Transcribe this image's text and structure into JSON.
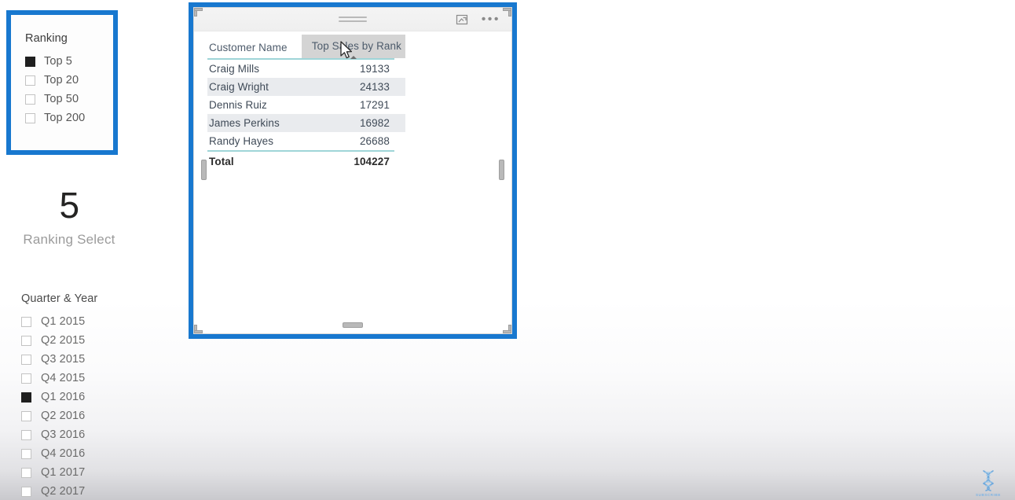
{
  "ranking_slicer": {
    "title": "Ranking",
    "items": [
      {
        "label": "Top 5",
        "checked": true
      },
      {
        "label": "Top 20",
        "checked": false
      },
      {
        "label": "Top 50",
        "checked": false
      },
      {
        "label": "Top 200",
        "checked": false
      }
    ]
  },
  "card": {
    "value": "5",
    "label": "Ranking Select"
  },
  "quarter_slicer": {
    "title": "Quarter & Year",
    "items": [
      {
        "label": "Q1 2015",
        "checked": false
      },
      {
        "label": "Q2 2015",
        "checked": false
      },
      {
        "label": "Q3 2015",
        "checked": false
      },
      {
        "label": "Q4 2015",
        "checked": false
      },
      {
        "label": "Q1 2016",
        "checked": true
      },
      {
        "label": "Q2 2016",
        "checked": false
      },
      {
        "label": "Q3 2016",
        "checked": false
      },
      {
        "label": "Q4 2016",
        "checked": false
      },
      {
        "label": "Q1 2017",
        "checked": false
      },
      {
        "label": "Q2 2017",
        "checked": false
      }
    ]
  },
  "table_visual": {
    "header_icons": {
      "focus_mode": "focus-mode-icon",
      "more_options": "•••"
    },
    "columns": [
      "Customer Name",
      "Top Sales by Rank"
    ],
    "sorted_column": "Top Sales by Rank",
    "sort_direction": "ascending",
    "rows": [
      {
        "name": "Craig Mills",
        "value": "19133"
      },
      {
        "name": "Craig Wright",
        "value": "24133"
      },
      {
        "name": "Dennis Ruiz",
        "value": "17291"
      },
      {
        "name": "James Perkins",
        "value": "16982"
      },
      {
        "name": "Randy Hayes",
        "value": "26688"
      }
    ],
    "total": {
      "label": "Total",
      "value": "104227"
    }
  },
  "subscribe_badge": {
    "text": "SUBSCRIBE"
  },
  "colors": {
    "highlight_blue": "#1878cf",
    "header_rule_teal": "#9fd5d8",
    "alt_row": "#e9ebee",
    "sorted_header_bg": "#d4d4d4"
  }
}
